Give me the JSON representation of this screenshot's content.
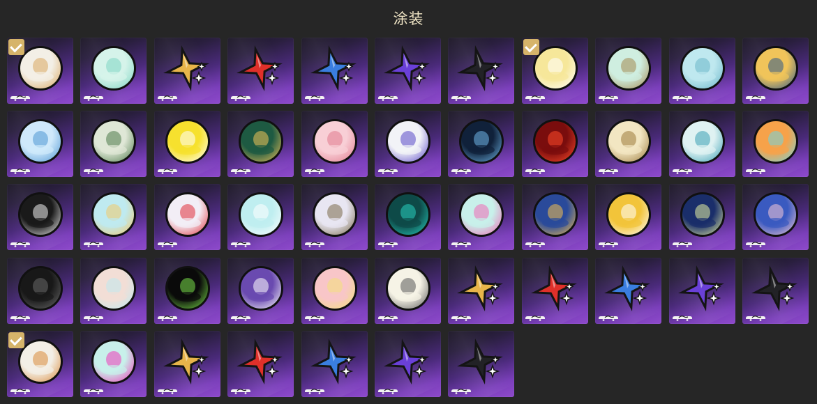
{
  "header": {
    "title": "涂装"
  },
  "colors": {
    "check": "#d6b46a",
    "gold": "#e8b54a",
    "red": "#e0302a",
    "blue": "#3a7ee0",
    "purple": "#6a40d8",
    "black": "#222226"
  },
  "tiles": [
    {
      "kind": "circle",
      "icon": "skin-portrait-icon",
      "palette": [
        "#f3efe6",
        "#d9a861"
      ],
      "equipped": true
    },
    {
      "kind": "circle",
      "icon": "skin-wave-icon",
      "palette": [
        "#d5f3ea",
        "#7fd6c2"
      ],
      "equipped": false
    },
    {
      "kind": "star",
      "icon": "star-emblem-icon",
      "color": "gold",
      "equipped": false
    },
    {
      "kind": "star",
      "icon": "star-emblem-icon",
      "color": "red",
      "equipped": false
    },
    {
      "kind": "star",
      "icon": "star-emblem-icon",
      "color": "blue",
      "equipped": false
    },
    {
      "kind": "star",
      "icon": "star-emblem-icon",
      "color": "purple",
      "equipped": false
    },
    {
      "kind": "star",
      "icon": "star-emblem-icon",
      "color": "black",
      "equipped": false
    },
    {
      "kind": "circle",
      "icon": "skin-portrait-icon",
      "palette": [
        "#f6e79a",
        "#ffffff"
      ],
      "equipped": true
    },
    {
      "kind": "circle",
      "icon": "skin-mascot-icon",
      "palette": [
        "#cfeee0",
        "#a48a52"
      ],
      "equipped": false
    },
    {
      "kind": "circle",
      "icon": "skin-wave-icon",
      "palette": [
        "#bfe8ef",
        "#6bb6c9"
      ],
      "equipped": false
    },
    {
      "kind": "circle",
      "icon": "skin-sand-icon",
      "palette": [
        "#f0c45a",
        "#2e5a8c"
      ],
      "equipped": false
    },
    {
      "kind": "circle",
      "icon": "skin-wave-icon",
      "palette": [
        "#cfe9fb",
        "#4f97d4"
      ],
      "equipped": false
    },
    {
      "kind": "circle",
      "icon": "skin-mascot-icon",
      "palette": [
        "#dfe7d6",
        "#4d7a4a"
      ],
      "equipped": false
    },
    {
      "kind": "circle",
      "icon": "skin-mascot-icon",
      "palette": [
        "#f6e12e",
        "#ffffff"
      ],
      "equipped": false
    },
    {
      "kind": "circle",
      "icon": "skin-emblem-icon",
      "palette": [
        "#1e5a42",
        "#f0c45a"
      ],
      "equipped": false
    },
    {
      "kind": "circle",
      "icon": "skin-portrait-icon",
      "palette": [
        "#f8cfd6",
        "#e07a8e"
      ],
      "equipped": false
    },
    {
      "kind": "circle",
      "icon": "skin-emblem-icon",
      "palette": [
        "#f2f3f7",
        "#5a48c8"
      ],
      "equipped": false
    },
    {
      "kind": "circle",
      "icon": "skin-tree-icon",
      "palette": [
        "#10213a",
        "#6fb7e8"
      ],
      "equipped": false
    },
    {
      "kind": "circle",
      "icon": "skin-flame-icon",
      "palette": [
        "#7a0d0d",
        "#ff4a2a"
      ],
      "equipped": false
    },
    {
      "kind": "circle",
      "icon": "skin-gear-icon",
      "palette": [
        "#f2e6c2",
        "#9c7a3c"
      ],
      "equipped": false
    },
    {
      "kind": "circle",
      "icon": "skin-mascot-icon",
      "palette": [
        "#dff2f2",
        "#3aa0b4"
      ],
      "equipped": false
    },
    {
      "kind": "circle",
      "icon": "skin-emblem-icon",
      "palette": [
        "#f6a24a",
        "#6fd6e0"
      ],
      "equipped": false
    },
    {
      "kind": "circle",
      "icon": "skin-target-icon",
      "palette": [
        "#1a1a1a",
        "#f0f0f0"
      ],
      "equipped": false
    },
    {
      "kind": "circle",
      "icon": "skin-portrait-icon",
      "palette": [
        "#bfeaf0",
        "#f2c86a"
      ],
      "equipped": false
    },
    {
      "kind": "circle",
      "icon": "skin-slash-icon",
      "palette": [
        "#f2eef6",
        "#e0303a"
      ],
      "equipped": false
    },
    {
      "kind": "circle",
      "icon": "skin-mascot-icon",
      "palette": [
        "#bfeef0",
        "#ffffff"
      ],
      "equipped": false
    },
    {
      "kind": "circle",
      "icon": "skin-orb-icon",
      "palette": [
        "#e8e6f2",
        "#7a6a4a"
      ],
      "equipped": false
    },
    {
      "kind": "circle",
      "icon": "skin-triangle-icon",
      "palette": [
        "#0e4a48",
        "#28d0c0"
      ],
      "equipped": false
    },
    {
      "kind": "circle",
      "icon": "skin-slime-icon",
      "palette": [
        "#c8f0ea",
        "#f06ab4"
      ],
      "equipped": false
    },
    {
      "kind": "circle",
      "icon": "skin-penguin-icon",
      "palette": [
        "#2a4a9a",
        "#f2c050"
      ],
      "equipped": false
    },
    {
      "kind": "circle",
      "icon": "skin-cow-icon",
      "palette": [
        "#f2c43a",
        "#ffffff"
      ],
      "equipped": false
    },
    {
      "kind": "circle",
      "icon": "skin-dome-icon",
      "palette": [
        "#1a2e6a",
        "#e6f0a0"
      ],
      "equipped": false
    },
    {
      "kind": "circle",
      "icon": "skin-portrait-icon",
      "palette": [
        "#3a5ac0",
        "#f6c8d6"
      ],
      "equipped": false
    },
    {
      "kind": "circle",
      "icon": "skin-monster-icon",
      "palette": [
        "#181818",
        "#6a6a6a"
      ],
      "equipped": false
    },
    {
      "kind": "circle",
      "icon": "skin-mascot-icon",
      "palette": [
        "#f2ded6",
        "#bfeaf0"
      ],
      "equipped": false
    },
    {
      "kind": "circle",
      "icon": "skin-monster-icon",
      "palette": [
        "#0a0a0a",
        "#7ae04a"
      ],
      "equipped": false
    },
    {
      "kind": "circle",
      "icon": "skin-emblem-icon",
      "palette": [
        "#6a4ab0",
        "#ffffff"
      ],
      "equipped": false
    },
    {
      "kind": "circle",
      "icon": "skin-mascot-icon",
      "palette": [
        "#f8c6c8",
        "#f2e27a"
      ],
      "equipped": false
    },
    {
      "kind": "circle",
      "icon": "skin-cube-icon",
      "palette": [
        "#f6f3e6",
        "#5a5a5a"
      ],
      "equipped": false
    },
    {
      "kind": "star",
      "icon": "star-emblem-icon",
      "color": "gold",
      "equipped": false
    },
    {
      "kind": "star",
      "icon": "star-emblem-icon",
      "color": "red",
      "equipped": false
    },
    {
      "kind": "star",
      "icon": "star-emblem-icon",
      "color": "blue",
      "equipped": false
    },
    {
      "kind": "star",
      "icon": "star-emblem-icon",
      "color": "purple",
      "equipped": false
    },
    {
      "kind": "star",
      "icon": "star-emblem-icon",
      "color": "black",
      "equipped": false
    },
    {
      "kind": "circle",
      "icon": "skin-portrait-icon",
      "palette": [
        "#f3efe6",
        "#d98a3a"
      ],
      "equipped": true
    },
    {
      "kind": "circle",
      "icon": "skin-cat-icon",
      "palette": [
        "#c8f0ea",
        "#f03ab8"
      ],
      "equipped": false
    },
    {
      "kind": "star",
      "icon": "star-emblem-icon",
      "color": "gold",
      "equipped": false
    },
    {
      "kind": "star",
      "icon": "star-emblem-icon",
      "color": "red",
      "equipped": false
    },
    {
      "kind": "star",
      "icon": "star-emblem-icon",
      "color": "blue",
      "equipped": false
    },
    {
      "kind": "star",
      "icon": "star-emblem-icon",
      "color": "purple",
      "equipped": false
    },
    {
      "kind": "star",
      "icon": "star-emblem-icon",
      "color": "black",
      "equipped": false
    }
  ]
}
